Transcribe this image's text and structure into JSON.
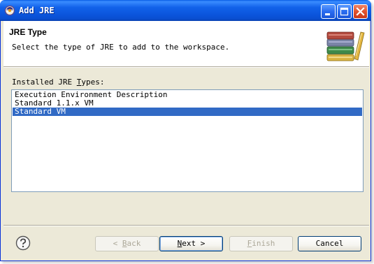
{
  "window": {
    "title": "Add JRE"
  },
  "header": {
    "title": "JRE Type",
    "description": "Select the type of JRE to add to the workspace."
  },
  "list": {
    "label_prefix": "Installed JRE ",
    "label_mnemonic": "T",
    "label_suffix": "ypes:",
    "items": [
      {
        "label": "Execution Environment Description",
        "selected": false
      },
      {
        "label": "Standard 1.1.x VM",
        "selected": false
      },
      {
        "label": "Standard VM",
        "selected": true
      }
    ]
  },
  "buttons": {
    "back": {
      "prefix": "< ",
      "mnemonic": "B",
      "suffix": "ack",
      "enabled": false
    },
    "next": {
      "mnemonic": "N",
      "suffix": "ext >",
      "enabled": true
    },
    "finish": {
      "mnemonic": "F",
      "suffix": "inish",
      "enabled": false
    },
    "cancel": {
      "label": "Cancel",
      "enabled": true
    }
  },
  "icons": {
    "title": "eclipse-icon",
    "header": "books-banner-icon",
    "help": "help-icon"
  },
  "colors": {
    "titlebar": "#0a5ee6",
    "selection": "#316ac5",
    "dialog_bg": "#ece9d8"
  }
}
